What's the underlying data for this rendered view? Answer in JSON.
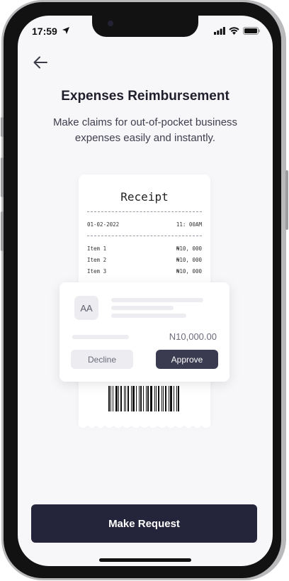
{
  "status_bar": {
    "time": "17:59"
  },
  "header": {
    "back_icon": "arrow-left-icon"
  },
  "title": "Expenses Reimbursement",
  "subtitle": "Make claims for out-of-pocket business expenses easily and instantly.",
  "receipt": {
    "title": "Receipt",
    "date": "01-02-2022",
    "time": "11: 00AM",
    "items": [
      {
        "name": "Item 1",
        "amount": "₦10, 000"
      },
      {
        "name": "Item 2",
        "amount": "₦10, 000"
      },
      {
        "name": "Item 3",
        "amount": "₦10, 000"
      }
    ]
  },
  "approval_card": {
    "avatar_initials": "AA",
    "amount": "N10,000.00",
    "decline_label": "Decline",
    "approve_label": "Approve"
  },
  "cta": {
    "label": "Make Request"
  },
  "colors": {
    "screen_bg": "#f7f7f9",
    "primary_dark": "#24243a",
    "approve_bg": "#3a3a50",
    "muted_bg": "#ececf1"
  }
}
